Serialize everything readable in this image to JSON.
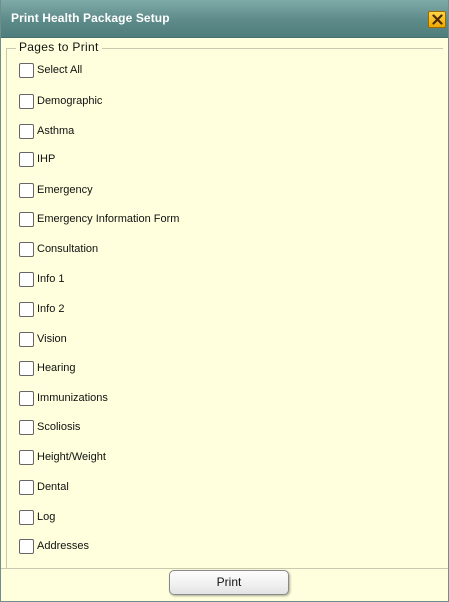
{
  "dialog": {
    "title": "Print Health Package Setup",
    "close_icon": "close-icon",
    "colors": {
      "titlebar": "#5d8b89",
      "background": "#ffffdd",
      "close_button": "#f0a800"
    }
  },
  "pages": {
    "legend": "Pages to Print",
    "items": [
      {
        "label": "Select All",
        "checked": false
      },
      {
        "label": "Demographic",
        "checked": false
      },
      {
        "label": "Asthma",
        "checked": false
      },
      {
        "label": "IHP",
        "checked": false
      },
      {
        "label": "Emergency",
        "checked": false
      },
      {
        "label": "Emergency Information Form",
        "checked": false
      },
      {
        "label": "Consultation",
        "checked": false
      },
      {
        "label": "Info 1",
        "checked": false
      },
      {
        "label": "Info 2",
        "checked": false
      },
      {
        "label": "Vision",
        "checked": false
      },
      {
        "label": "Hearing",
        "checked": false
      },
      {
        "label": "Immunizations",
        "checked": false
      },
      {
        "label": "Scoliosis",
        "checked": false
      },
      {
        "label": "Height/Weight",
        "checked": false
      },
      {
        "label": "Dental",
        "checked": false
      },
      {
        "label": "Log",
        "checked": false
      },
      {
        "label": "Addresses",
        "checked": false
      }
    ]
  },
  "footer": {
    "print_label": "Print"
  }
}
